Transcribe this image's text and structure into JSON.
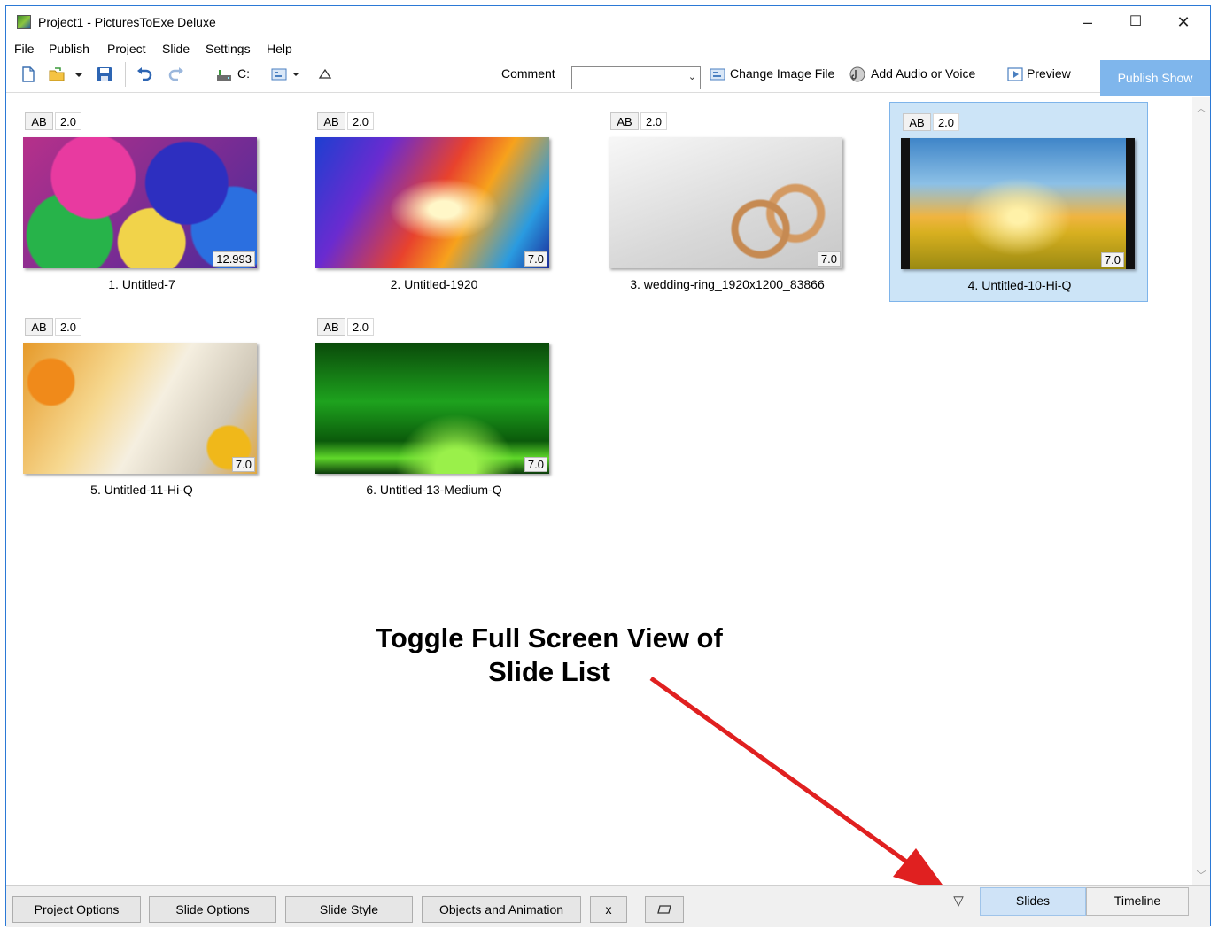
{
  "window": {
    "title": "Project1 - PicturesToExe Deluxe",
    "min": "–",
    "max": "☐",
    "close": "✕"
  },
  "menu": [
    "File",
    "Publish",
    "Project",
    "Slide",
    "Settings",
    "Help"
  ],
  "toolbar": {
    "drive": "C:",
    "comment_label": "Comment",
    "comment_value": "",
    "change_image": "Change Image File",
    "add_audio": "Add Audio or Voice",
    "preview": "Preview",
    "publish": "Publish Show"
  },
  "slides": [
    {
      "ab": "AB",
      "transition": "2.0",
      "duration": "12.993",
      "name": "1. Untitled-7",
      "selected": false
    },
    {
      "ab": "AB",
      "transition": "2.0",
      "duration": "7.0",
      "name": "2. Untitled-1920",
      "selected": false
    },
    {
      "ab": "AB",
      "transition": "2.0",
      "duration": "7.0",
      "name": "3. wedding-ring_1920x1200_83866",
      "selected": false
    },
    {
      "ab": "AB",
      "transition": "2.0",
      "duration": "7.0",
      "name": "4. Untitled-10-Hi-Q",
      "selected": true
    },
    {
      "ab": "AB",
      "transition": "2.0",
      "duration": "7.0",
      "name": "5. Untitled-11-Hi-Q",
      "selected": false
    },
    {
      "ab": "AB",
      "transition": "2.0",
      "duration": "7.0",
      "name": "6. Untitled-13-Medium-Q",
      "selected": false
    }
  ],
  "annotation": {
    "line1": "Toggle Full Screen View of",
    "line2": "Slide List",
    "arrow_color": "#e02020"
  },
  "bottom": {
    "project_options": "Project Options",
    "slide_options": "Slide Options",
    "slide_style": "Slide Style",
    "objects_animation": "Objects and Animation",
    "x": "x",
    "toggle_icon": "▽",
    "tab_slides": "Slides",
    "tab_timeline": "Timeline"
  },
  "colors": {
    "accent": "#7fb6ec",
    "selection": "#cce4f7"
  }
}
